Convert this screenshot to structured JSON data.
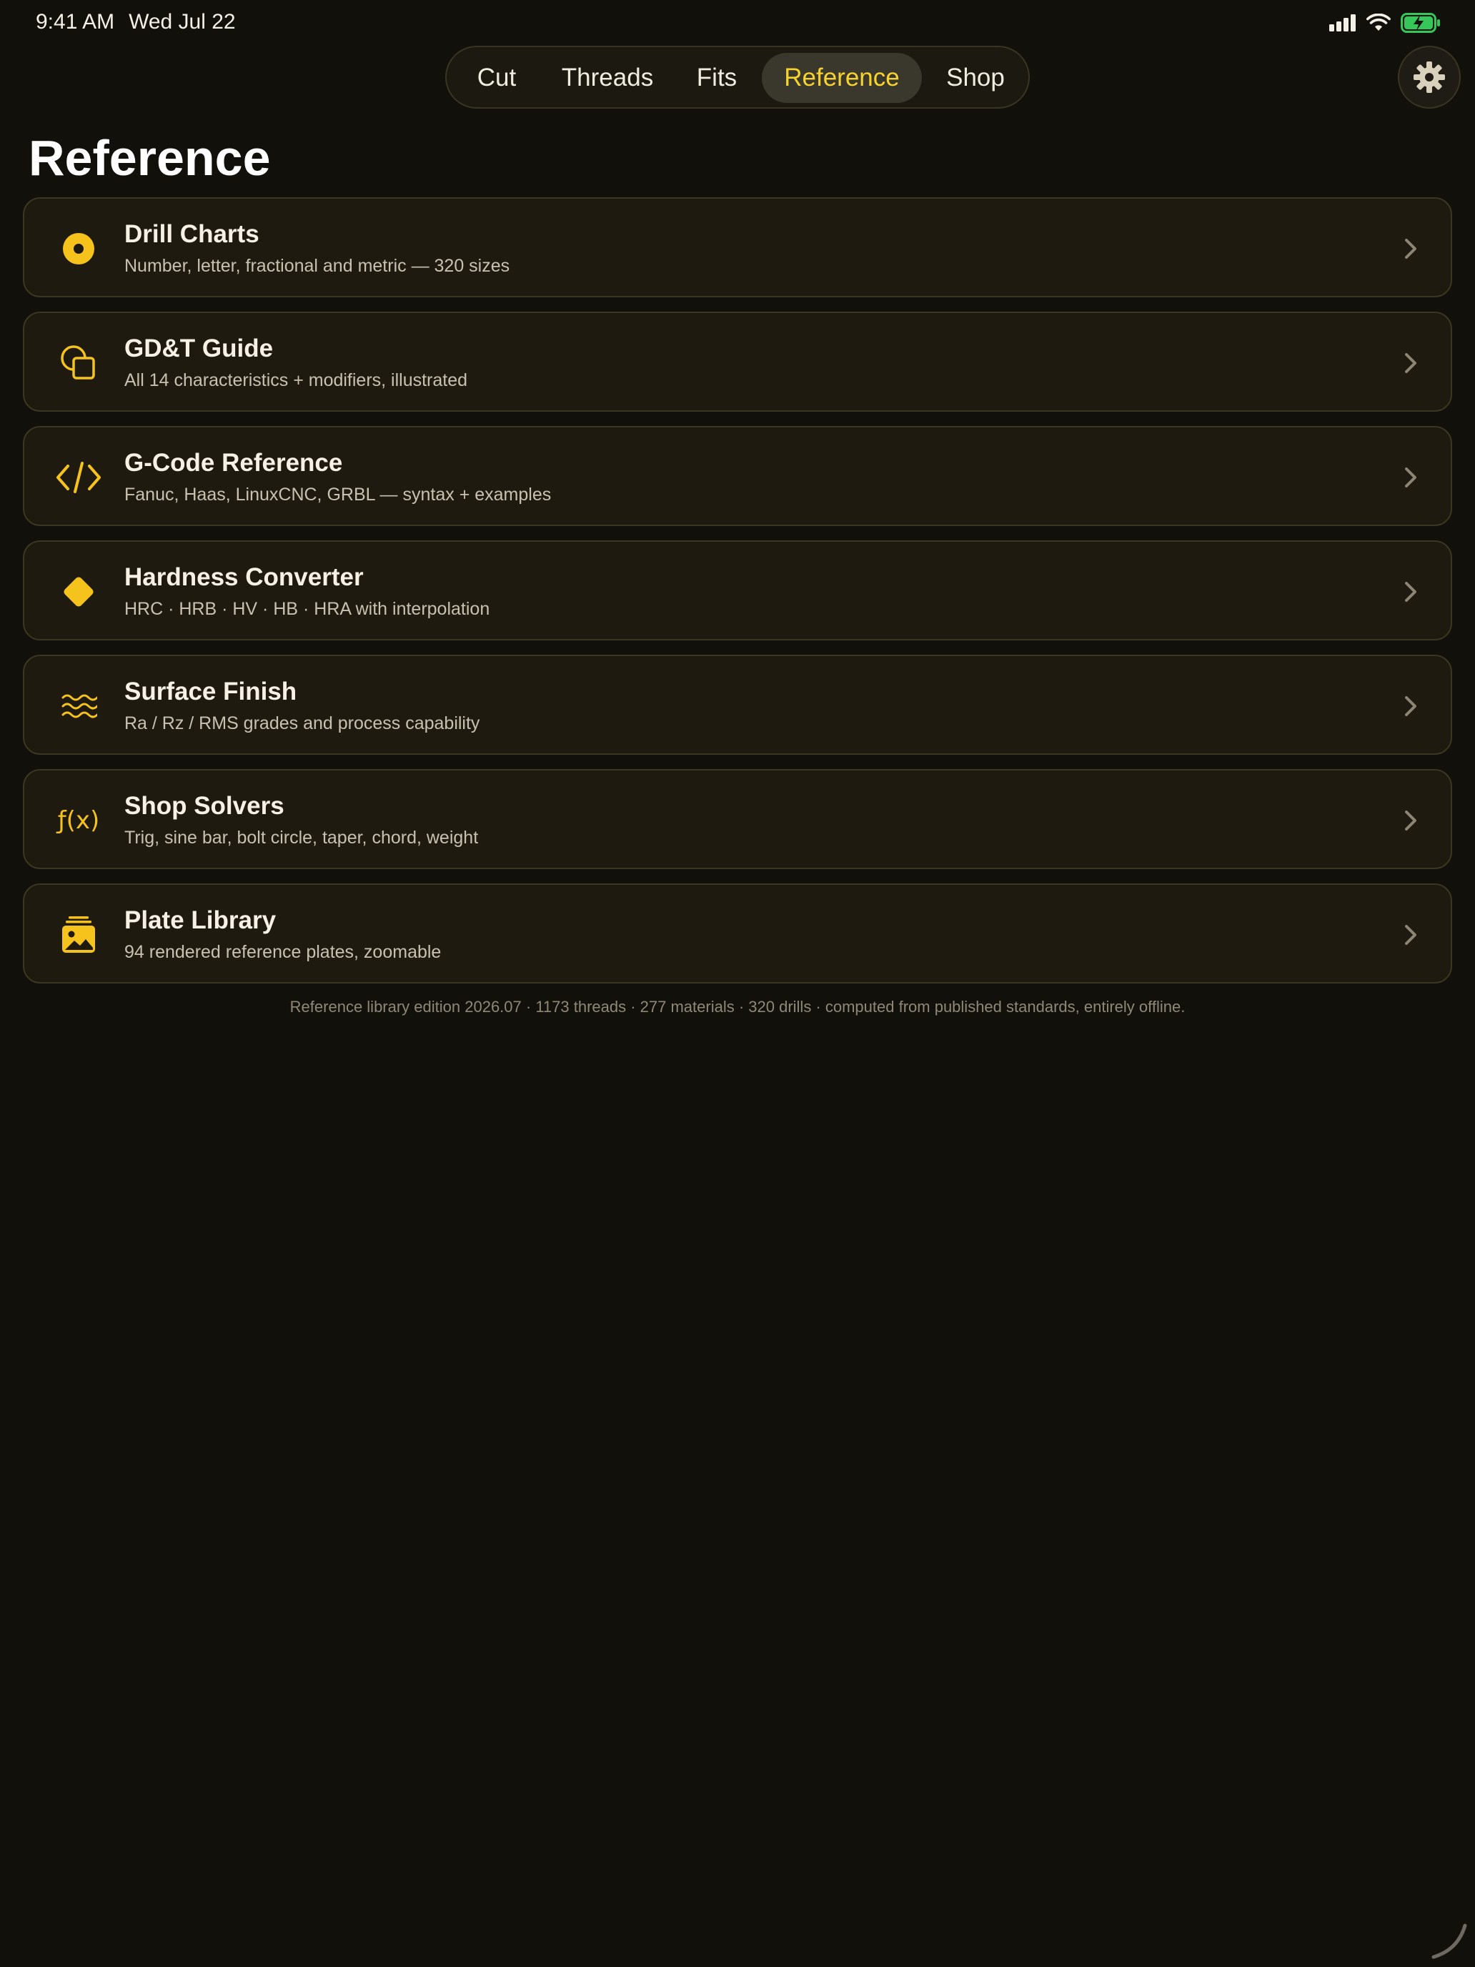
{
  "status_bar": {
    "time": "9:41 AM",
    "date": "Wed Jul 22",
    "icons": [
      "cellular-signal-icon",
      "wifi-icon",
      "battery-charging-icon"
    ]
  },
  "tabs": [
    {
      "label": "Cut",
      "active": false
    },
    {
      "label": "Threads",
      "active": false
    },
    {
      "label": "Fits",
      "active": false
    },
    {
      "label": "Reference",
      "active": true
    },
    {
      "label": "Shop",
      "active": false
    }
  ],
  "settings": {
    "icon": "gear-icon"
  },
  "page": {
    "title": "Reference"
  },
  "items": [
    {
      "title": "Drill Charts",
      "subtitle": "Number, letter, fractional and metric — 320 sizes",
      "icon": "target-dot-icon"
    },
    {
      "title": "GD&T Guide",
      "subtitle": "All 14 characteristics + modifiers, illustrated",
      "icon": "shapes-overlap-icon"
    },
    {
      "title": "G-Code Reference",
      "subtitle": "Fanuc, Haas, LinuxCNC, GRBL — syntax + examples",
      "icon": "code-brackets-icon"
    },
    {
      "title": "Hardness Converter",
      "subtitle": "HRC · HRB · HV · HB · HRA with interpolation",
      "icon": "diamond-icon"
    },
    {
      "title": "Surface Finish",
      "subtitle": "Ra / Rz / RMS grades and process capability",
      "icon": "waves-icon"
    },
    {
      "title": "Shop Solvers",
      "subtitle": "Trig, sine bar, bolt circle, taper, chord, weight",
      "icon": "function-icon",
      "icon_text": "ƒ(x)"
    },
    {
      "title": "Plate Library",
      "subtitle": "94 rendered reference plates, zoomable",
      "icon": "photo-stack-icon"
    }
  ],
  "footer": {
    "note": "Reference library edition 2026.07 · 1173 threads · 277 materials · 320 drills · computed from published standards, entirely offline."
  },
  "colors": {
    "background": "#12100a",
    "accent": "#f6c21c",
    "active_tab_text": "#f6d32d",
    "card_background": "#1f1a10",
    "battery": "#35c759"
  }
}
